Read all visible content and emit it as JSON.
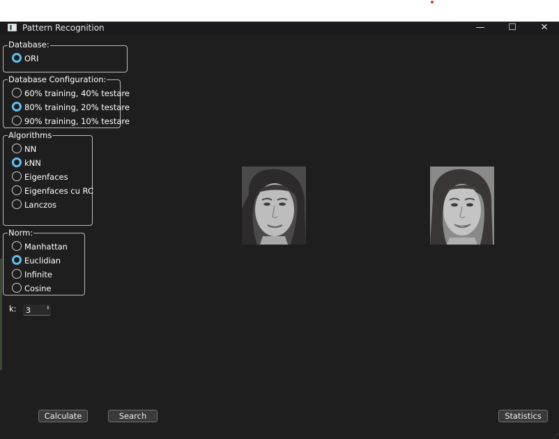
{
  "window": {
    "title": "Pattern Recognition",
    "controls": {
      "minimize": "—",
      "maximize": "☐",
      "close": "✕"
    }
  },
  "groups": {
    "database": {
      "title": "Database:",
      "options": [
        {
          "label": "ORI",
          "selected": true
        }
      ]
    },
    "database_configuration": {
      "title": "Database Configuration:",
      "options": [
        {
          "label": "60% training, 40% testare",
          "selected": false
        },
        {
          "label": "80% training, 20% testare",
          "selected": true
        },
        {
          "label": "90% training, 10% testare",
          "selected": false
        }
      ]
    },
    "algorithms": {
      "title": "Algorithms",
      "options": [
        {
          "label": "NN",
          "selected": false
        },
        {
          "label": "kNN",
          "selected": true
        },
        {
          "label": "Eigenfaces",
          "selected": false
        },
        {
          "label": "Eigenfaces cu RC",
          "selected": false
        },
        {
          "label": "Lanczos",
          "selected": false
        }
      ]
    },
    "norm": {
      "title": "Norm:",
      "options": [
        {
          "label": "Manhattan",
          "selected": false
        },
        {
          "label": "Euclidian",
          "selected": true
        },
        {
          "label": "Infinite",
          "selected": false
        },
        {
          "label": "Cosine",
          "selected": false
        }
      ]
    }
  },
  "k": {
    "label": "k:",
    "value": "3"
  },
  "buttons": {
    "calculate": "Calculate",
    "search": "Search",
    "statistics": "Statistics"
  },
  "colors": {
    "accent": "#62c0f0",
    "background": "#1e1e1e",
    "titlebar": "#1b1b1e"
  }
}
